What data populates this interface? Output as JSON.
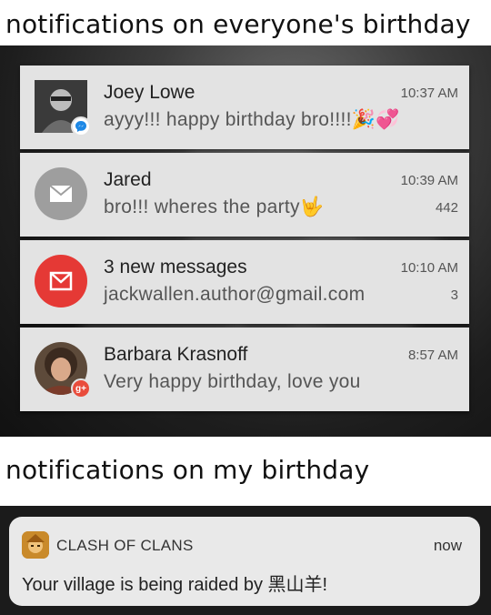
{
  "captions": {
    "top": "notifications on everyone's birthday",
    "bottom": "notifications on my birthday"
  },
  "notifications": [
    {
      "name": "Joey Lowe",
      "message": "ayyy!!! happy birthday bro!!!!🎉💞",
      "time": "10:37 AM",
      "count": "",
      "badge_icon": "messenger-icon",
      "badge_color": "#ffffff"
    },
    {
      "name": "Jared",
      "message": "bro!!! wheres the party🤟",
      "time": "10:39 AM",
      "count": "442",
      "badge_icon": "envelope-icon",
      "avatar_color": "#9e9e9e"
    },
    {
      "name": "3 new messages",
      "message": "jackwallen.author@gmail.com",
      "time": "10:10 AM",
      "count": "3",
      "badge_icon": "gmail-icon",
      "avatar_color": "#e53935"
    },
    {
      "name": "Barbara Krasnoff",
      "message": "Very happy birthday, love you",
      "time": "8:57 AM",
      "count": "",
      "badge_icon": "google-plus-icon",
      "badge_color": "#e94c3c"
    }
  ],
  "game_notification": {
    "app": "CLASH OF CLANS",
    "time": "now",
    "message": "Your village is being raided by 黑山羊!"
  }
}
